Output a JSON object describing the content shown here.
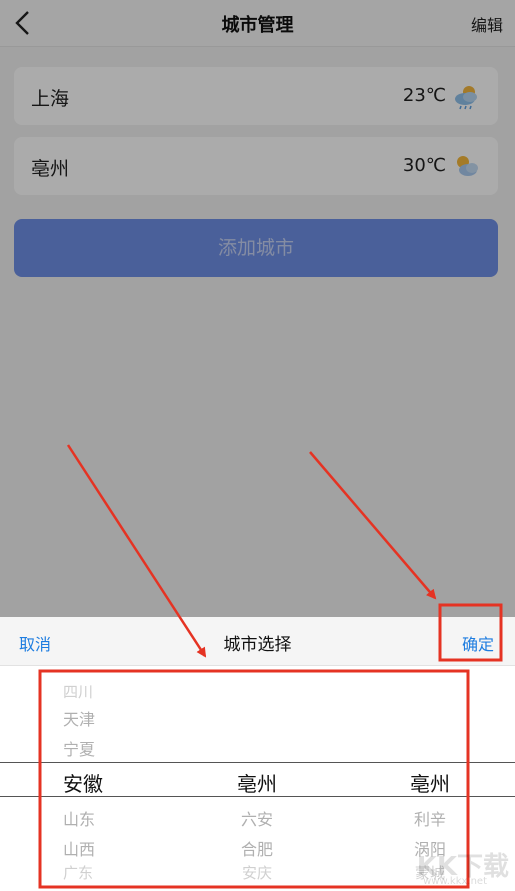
{
  "navbar": {
    "title": "城市管理",
    "edit": "编辑"
  },
  "cities": [
    {
      "name": "上海",
      "temp": "23℃",
      "weather_icon": "cloudy-icon"
    },
    {
      "name": "亳州",
      "temp": "30℃",
      "weather_icon": "partly-sunny-icon"
    }
  ],
  "add_button": {
    "label": "添加城市"
  },
  "picker": {
    "cancel": "取消",
    "title": "城市选择",
    "confirm": "确定",
    "province": {
      "above": [
        "四川",
        "天津",
        "宁夏"
      ],
      "selected": "安徽",
      "below": [
        "山东",
        "山西",
        "广东"
      ]
    },
    "city": {
      "selected": "亳州",
      "below": [
        "六安",
        "合肥",
        "安庆"
      ]
    },
    "district": {
      "selected": "亳州",
      "below": [
        "利辛",
        "涡阳",
        "蒙城"
      ]
    }
  },
  "colors": {
    "accent": "#1e7de0",
    "button": "#6f8fe6",
    "annotation": "#e53323"
  },
  "watermark": {
    "text": "KK下载",
    "sub": "www.kkx.net"
  }
}
